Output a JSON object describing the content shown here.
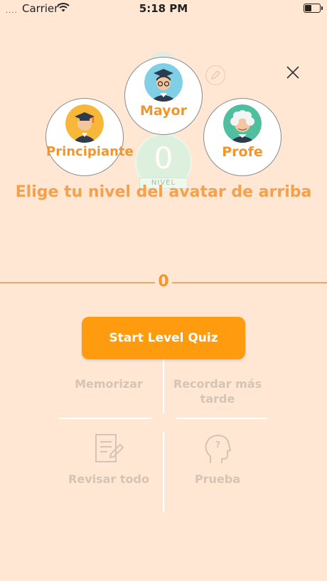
{
  "status_bar": {
    "signal": "....",
    "carrier": "Carrier",
    "time": "5:18 PM"
  },
  "level": {
    "value": "0",
    "label": "NIVEL"
  },
  "avatars": [
    {
      "name": "Principiante"
    },
    {
      "name": "Mayor"
    },
    {
      "name": "Profe"
    }
  ],
  "instruction": "Elige tu nivel del avatar de arriba",
  "score": "0",
  "start_button": "Start Level Quiz",
  "menu": {
    "memorizar": "Memorizar",
    "recordar": "Recordar más tarde",
    "revisar": "Revisar todo",
    "prueba": "Prueba"
  },
  "colors": {
    "background": "#ffe7d4",
    "accent": "#ff9b0e",
    "text_orange": "#f0962a"
  }
}
